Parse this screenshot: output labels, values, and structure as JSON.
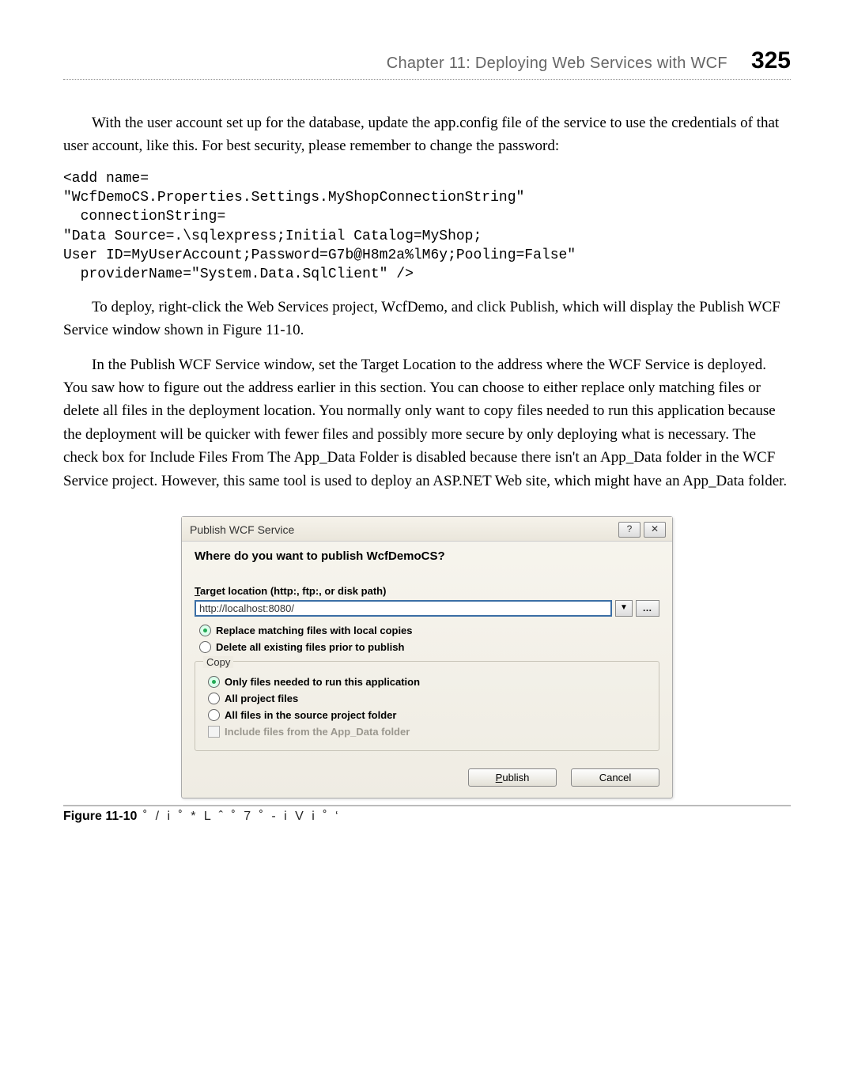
{
  "header": {
    "chapter": "Chapter 11:   Deploying Web Services with WCF",
    "pagenum": "325"
  },
  "para1": "With the user account set up for the database, update the app.config file of the service to use the credentials of that user account, like this. For best security, please remember to change the password:",
  "code": "<add name=\n\"WcfDemoCS.Properties.Settings.MyShopConnectionString\"\n  connectionString=\n\"Data Source=.\\sqlexpress;Initial Catalog=MyShop;\nUser ID=MyUserAccount;Password=G7b@H8m2a%lM6y;Pooling=False\"\n  providerName=\"System.Data.SqlClient\" />",
  "para2": "To deploy, right-click the Web Services project, WcfDemo, and click Publish, which will display the Publish WCF Service window shown in Figure 11-10.",
  "para3": "In the Publish WCF Service window, set the Target Location to the address where the WCF Service is deployed. You saw how to figure out the address earlier in this section. You can choose to either replace only matching files or delete all files in the deployment location. You normally only want to copy files needed to run this application because the deployment will be quicker with fewer files and possibly more secure by only deploying what is necessary. The check box for Include Files From The App_Data Folder is disabled because there isn't an App_Data folder in the WCF Service project. However, this same tool is used to deploy an ASP.NET Web site, which might have an App_Data folder.",
  "dialog": {
    "title": "Publish WCF Service",
    "heading": "Where do you want to publish WcfDemoCS?",
    "target_label_pre": "T",
    "target_label_rest": "arget location (http:, ftp:, or disk path)",
    "target_value": "http://localhost:8080/",
    "r1_pre": "R",
    "r1_rest": "eplace matching files with local copies",
    "r2_pre": "D",
    "r2_rest": "elete all existing files prior to publish",
    "group_title": "Copy",
    "c1_pre": "Only files needed to r",
    "c1_u": "u",
    "c1_post": "n this application",
    "c2_pre": "A",
    "c2_rest": "ll project files",
    "c3_pre": "A",
    "c3_rest": "ll files in the source project folder",
    "c4_pre": "I",
    "c4_rest": "nclude files from the App_Data folder",
    "publish_u": "P",
    "publish_rest": "ublish",
    "cancel": "Cancel"
  },
  "figure": {
    "label": "Figure 11-10",
    "garble": " ˚  /  i ˚ *   L    ˆ   ˚ 7    ˚ - i      V i ˚      ‘"
  }
}
